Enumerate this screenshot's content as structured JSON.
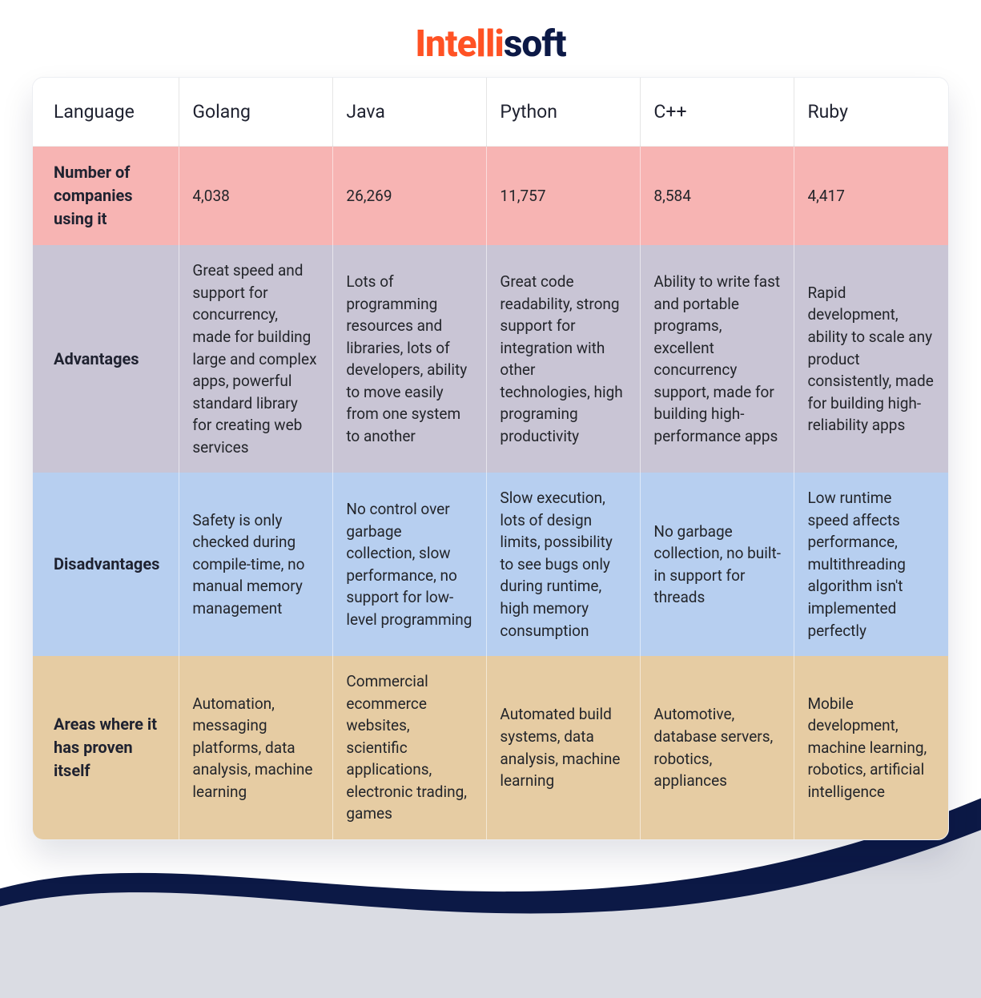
{
  "brand": {
    "accent_text": "Intelli",
    "rest_text": "soft"
  },
  "columns": [
    "Language",
    "Golang",
    "Java",
    "Python",
    "C++",
    "Ruby"
  ],
  "rows": [
    {
      "label": "Number of companies using it",
      "cells": [
        "4,038",
        "26,269",
        "11,757",
        "8,584",
        "4,417"
      ],
      "class": "row-pink"
    },
    {
      "label": "Advantages",
      "cells": [
        "Great speed and support for concurrency, made for building large and complex apps, powerful standard library for creating web services",
        "Lots of programming resources and libraries, lots of developers, ability to move easily from one system to another",
        "Great code readability, strong support for integration with other technologies, high programing productivity",
        "Ability to write fast and portable programs, excellent concurrency support, made for building high-performance apps",
        "Rapid development, ability to scale any product consistently, made for building high-reliability apps"
      ],
      "class": "row-lav"
    },
    {
      "label": "Disadvantages",
      "cells": [
        "Safety is only checked during compile-time, no manual memory management",
        "No control over garbage collection, slow performance, no support for low-level programming",
        "Slow execution, lots of design limits, possibility to see bugs only during runtime, high memory consumption",
        "No garbage collection, no built-in support for threads",
        "Low runtime speed affects performance, multithreading algorithm isn't implemented perfectly"
      ],
      "class": "row-blue"
    },
    {
      "label": "Areas where it has proven itself",
      "cells": [
        "Automation, messaging platforms, data analysis, machine learning",
        "Commercial ecommerce websites, scientific applications, electronic trading, games",
        "Automated build systems, data analysis, machine learning",
        "Automotive, database servers, robotics, appliances",
        "Mobile development, machine learning, robotics, artificial intelligence"
      ],
      "class": "row-tan"
    }
  ],
  "chart_data": {
    "type": "table",
    "title": "Programming language comparison",
    "columns": [
      "Golang",
      "Java",
      "Python",
      "C++",
      "Ruby"
    ],
    "rows": [
      {
        "metric": "Number of companies using it",
        "values": [
          4038,
          26269,
          11757,
          8584,
          4417
        ]
      },
      {
        "metric": "Advantages",
        "values": [
          "Great speed and support for concurrency, made for building large and complex apps, powerful standard library for creating web services",
          "Lots of programming resources and libraries, lots of developers, ability to move easily from one system to another",
          "Great code readability, strong support for integration with other technologies, high programing productivity",
          "Ability to write fast and portable programs, excellent concurrency support, made for building high-performance apps",
          "Rapid development, ability to scale any product consistently, made for building high-reliability apps"
        ]
      },
      {
        "metric": "Disadvantages",
        "values": [
          "Safety is only checked during compile-time, no manual memory management",
          "No control over garbage collection, slow performance, no support for low-level programming",
          "Slow execution, lots of design limits, possibility to see bugs only during runtime, high memory consumption",
          "No garbage collection, no built-in support for threads",
          "Low runtime speed affects performance, multithreading algorithm isn't implemented perfectly"
        ]
      },
      {
        "metric": "Areas where it has proven itself",
        "values": [
          "Automation, messaging platforms, data analysis, machine learning",
          "Commercial ecommerce websites, scientific applications, electronic trading, games",
          "Automated build systems, data analysis, machine learning",
          "Automotive, database servers, robotics, appliances",
          "Mobile development, machine learning, robotics, artificial intelligence"
        ]
      }
    ]
  }
}
